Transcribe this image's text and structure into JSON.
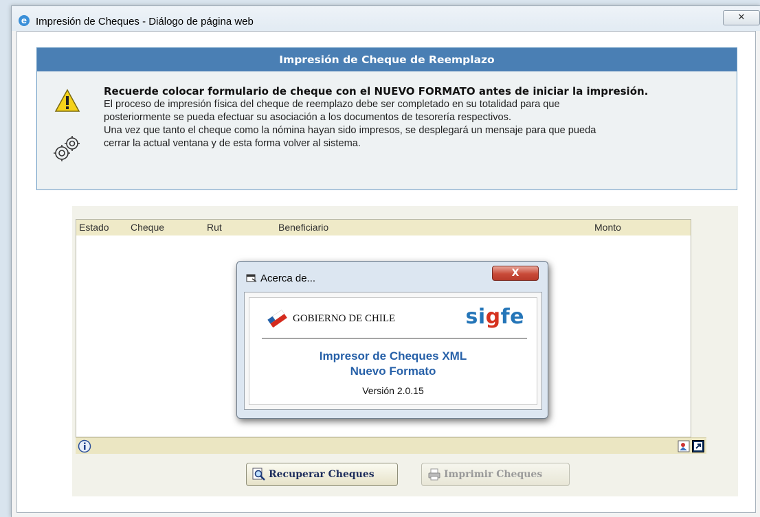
{
  "window": {
    "title": "Impresión de Cheques - Diálogo de página web",
    "close_label": "✕"
  },
  "panel": {
    "header": "Impresión de Cheque de Reemplazo",
    "lead": "Recuerde colocar formulario de cheque con el NUEVO FORMATO antes de iniciar la impresión.",
    "lines": [
      "El proceso de impresión física del cheque de reemplazo debe ser completado en su totalidad para que",
      "posteriormente se pueda efectuar su asociación a los documentos de tesorería respectivos.",
      "Una vez que tanto el cheque como la nómina hayan sido impresos, se desplegará un mensaje para que pueda",
      "cerrar la actual ventana y de esta forma volver al sistema."
    ]
  },
  "grid": {
    "columns": [
      "Estado",
      "Cheque",
      "Rut",
      "Beneficiario",
      "Monto"
    ],
    "rows": []
  },
  "buttons": {
    "recuperar": "Recuperar Cheques",
    "imprimir": "Imprimir Cheques"
  },
  "about": {
    "title": "Acerca de...",
    "close_label": "X",
    "org": "GOBIERNO DE CHILE",
    "brand_pre": "si",
    "brand_g": "g",
    "brand_post": "fe",
    "product_line1": "Impresor de Cheques XML",
    "product_line2": "Nuevo Formato",
    "version": "Versión 2.0.15"
  },
  "colors": {
    "panel_header": "#4a7fb4",
    "grid_header": "#efeac8",
    "brand_blue": "#2475b8",
    "brand_red": "#d5321f"
  },
  "icons": [
    "ie-icon",
    "warning-icon",
    "gear-icon",
    "info-icon",
    "print-preview-icon",
    "help-icon",
    "search-icon",
    "printer-icon",
    "window-icon",
    "chile-flag-logo"
  ]
}
